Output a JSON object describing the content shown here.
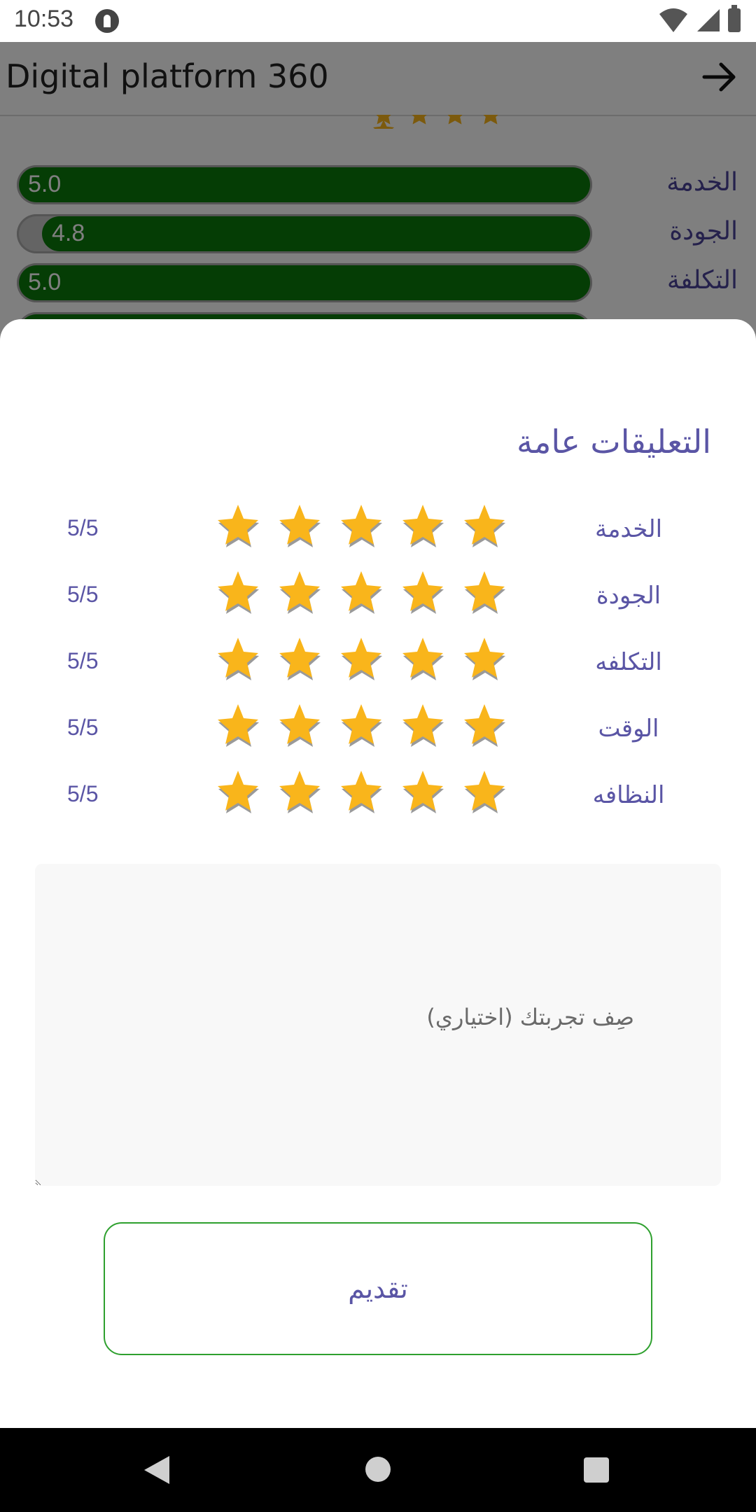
{
  "status_bar": {
    "time": "10:53"
  },
  "app_bar": {
    "title": "Digital platform 360"
  },
  "background_ratings": [
    {
      "label": "الخدمة",
      "value": "5.0",
      "fraction": 1.0
    },
    {
      "label": "الجودة",
      "value": "4.8",
      "fraction": 0.96
    },
    {
      "label": "التكلفة",
      "value": "5.0",
      "fraction": 1.0
    }
  ],
  "sheet": {
    "title": "التعليقات عامة",
    "criteria": [
      {
        "label": "الخدمة",
        "score": "5/5",
        "stars_filled": 5
      },
      {
        "label": "الجودة",
        "score": "5/5",
        "stars_filled": 5
      },
      {
        "label": "التكلفه",
        "score": "5/5",
        "stars_filled": 5
      },
      {
        "label": "الوقت",
        "score": "5/5",
        "stars_filled": 5
      },
      {
        "label": "النظافه",
        "score": "5/5",
        "stars_filled": 5
      }
    ],
    "comment_placeholder": "صِف تجربتك (اختياري)",
    "submit_label": "تقديم"
  },
  "colors": {
    "accent_text": "#5a55a5",
    "star": "#f9b51b",
    "progress_fill": "#0a7a0a",
    "button_border": "#2ea02e"
  },
  "icons": {
    "back": "arrow-right-icon",
    "star": "star-icon"
  }
}
